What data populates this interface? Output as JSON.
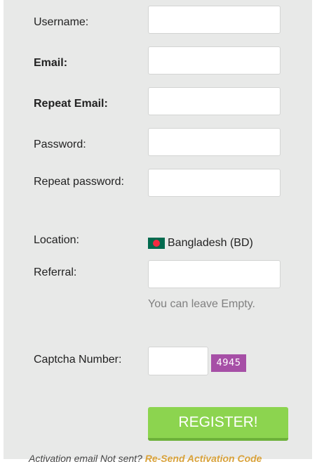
{
  "form": {
    "username_label": "Username:",
    "email_label": "Email:",
    "repeat_email_label": "Repeat Email:",
    "password_label": "Password:",
    "repeat_password_label": "Repeat password:",
    "location_label": "Location:",
    "location_value": "Bangladesh (BD)",
    "location_flag_icon": "bangladesh-flag-icon",
    "referral_label": "Referral:",
    "referral_hint": "You can leave Empty.",
    "captcha_label": "Captcha Number:",
    "captcha_code": "4945",
    "register_label": "REGISTER!"
  },
  "footer": {
    "text": "Activation email Not sent? ",
    "link": "Re-Send Activation Code"
  },
  "colors": {
    "panel_bg": "#e8e9e8",
    "register_bg": "#8cd44f",
    "captcha_bg": "#a64fa6",
    "hint": "#808080",
    "footer_link": "#d9a23a"
  }
}
